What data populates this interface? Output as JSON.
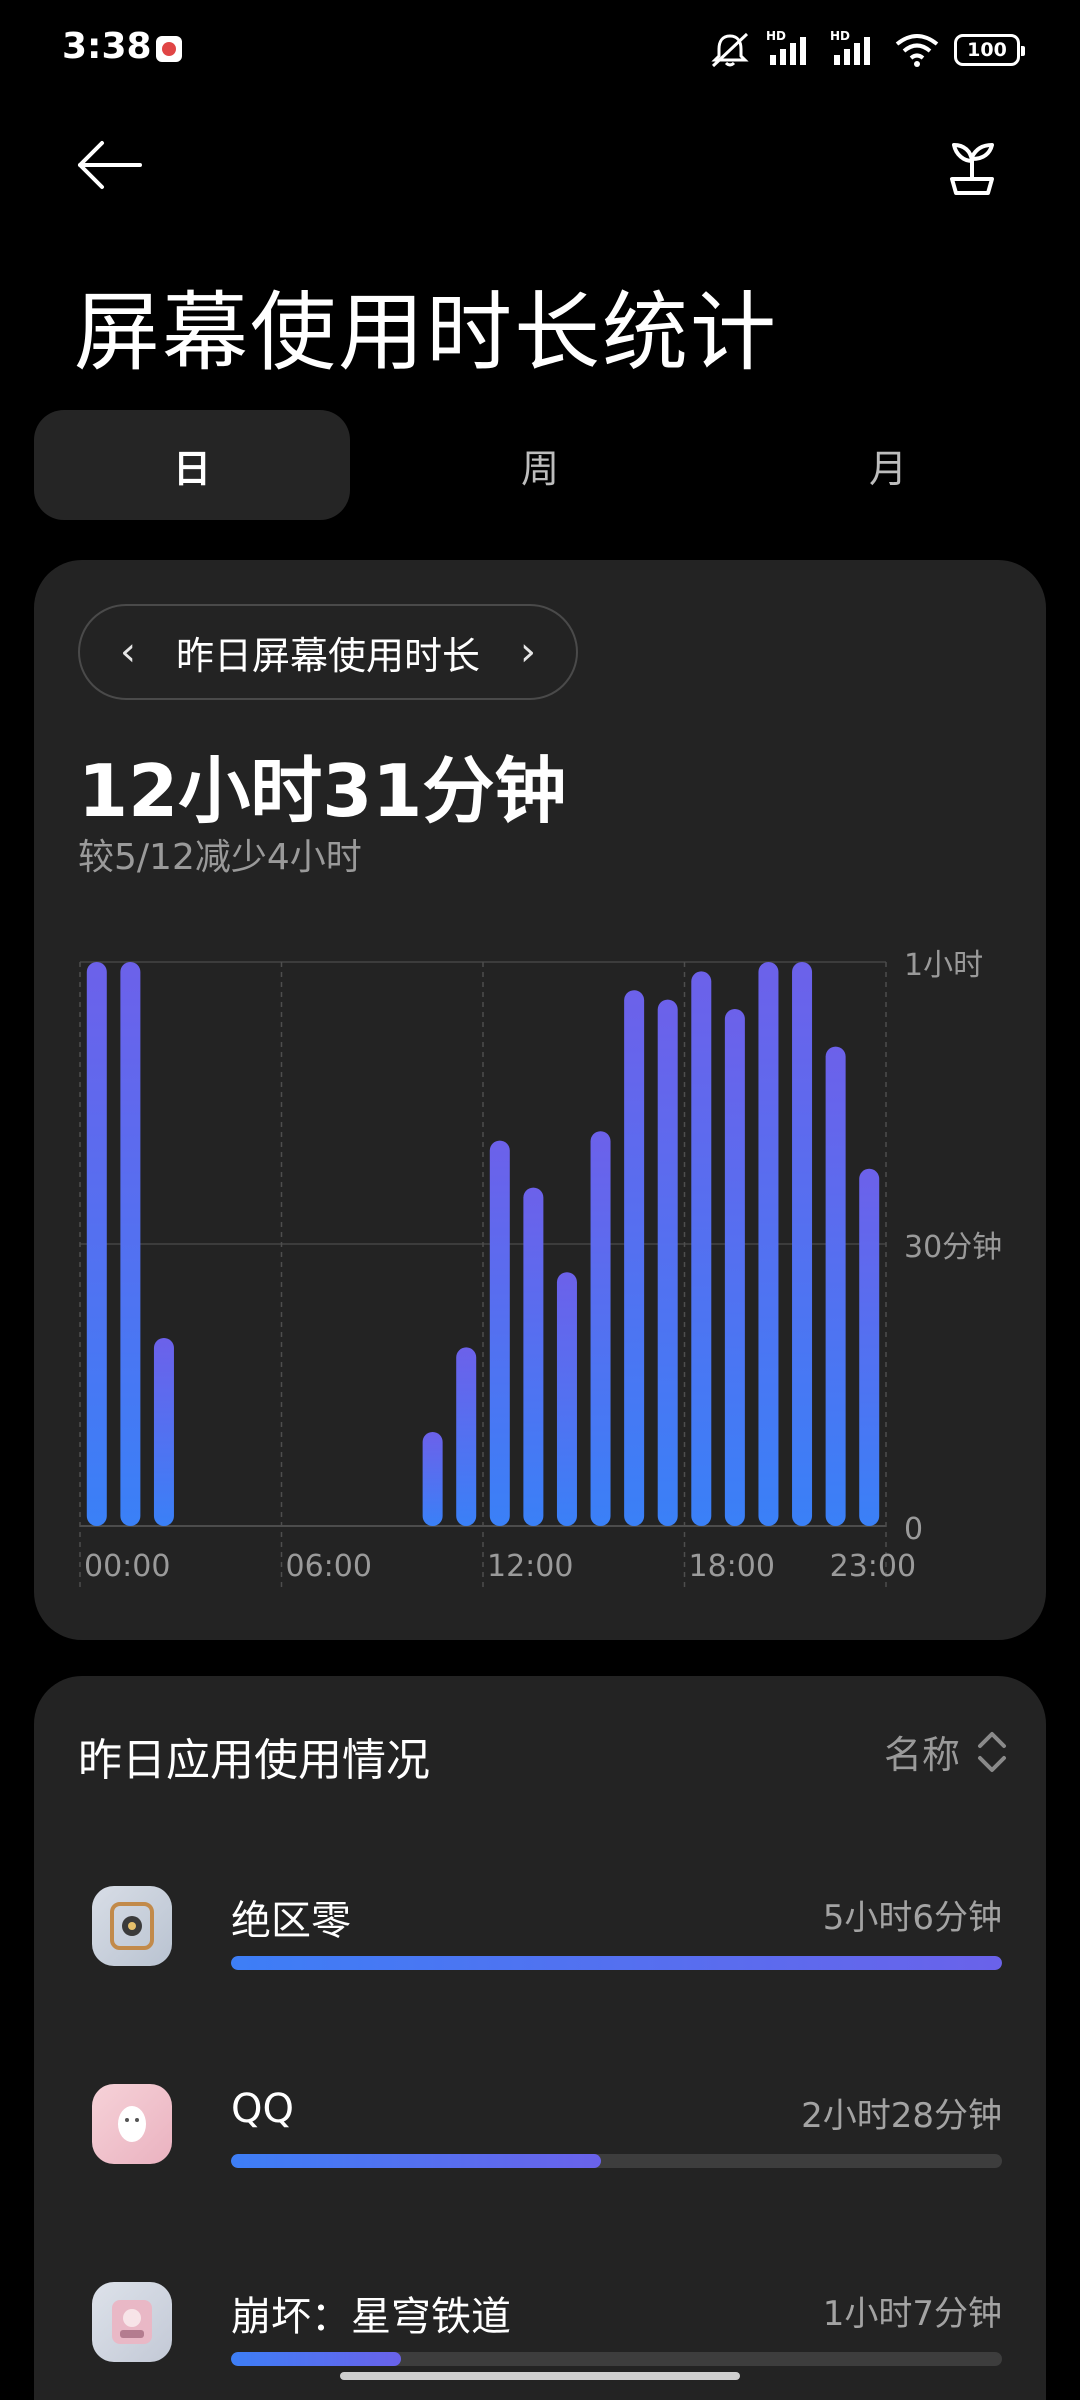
{
  "status_bar": {
    "time": "3:38",
    "icons": [
      "app-notification-icon",
      "mute-icon",
      "signal-hd-icon",
      "signal-hd-icon",
      "wifi-icon"
    ],
    "hd_label": "HD",
    "battery": "100"
  },
  "header": {
    "back_icon": "back-arrow-icon",
    "action_icon": "sprout-icon",
    "title": "屏幕使用时长统计"
  },
  "tabs": [
    {
      "label": "日",
      "active": true
    },
    {
      "label": "周",
      "active": false
    },
    {
      "label": "月",
      "active": false
    }
  ],
  "summary": {
    "period_label": "昨日屏幕使用时长",
    "total": "12小时31分钟",
    "comparison": "较5/12减少4小时"
  },
  "chart_data": {
    "type": "bar",
    "unit": "minutes",
    "x": [
      "00:00",
      "01:00",
      "02:00",
      "03:00",
      "04:00",
      "05:00",
      "06:00",
      "07:00",
      "08:00",
      "09:00",
      "10:00",
      "11:00",
      "12:00",
      "13:00",
      "14:00",
      "15:00",
      "16:00",
      "17:00",
      "18:00",
      "19:00",
      "20:00",
      "21:00",
      "22:00",
      "23:00"
    ],
    "values": [
      60,
      60,
      20,
      0,
      0,
      0,
      0,
      0,
      0,
      0,
      10,
      19,
      41,
      36,
      27,
      42,
      57,
      56,
      59,
      55,
      60,
      60,
      51,
      38
    ],
    "x_tick_labels": [
      "00:00",
      "06:00",
      "12:00",
      "18:00",
      "23:00"
    ],
    "y_tick_labels": [
      "0",
      "30分钟",
      "1小时"
    ],
    "ylim": [
      0,
      60
    ],
    "colors": {
      "bar_top": "#6c61ea",
      "bar_bottom": "#3a80f7"
    }
  },
  "apps_section": {
    "title": "昨日应用使用情况",
    "sort_label": "名称",
    "items": [
      {
        "name": "绝区零",
        "duration": "5小时6分钟",
        "fraction": 1.0
      },
      {
        "name": "QQ",
        "duration": "2小时28分钟",
        "fraction": 0.48
      },
      {
        "name": "崩坏：星穹铁道",
        "duration": "1小时7分钟",
        "fraction": 0.22
      }
    ]
  }
}
